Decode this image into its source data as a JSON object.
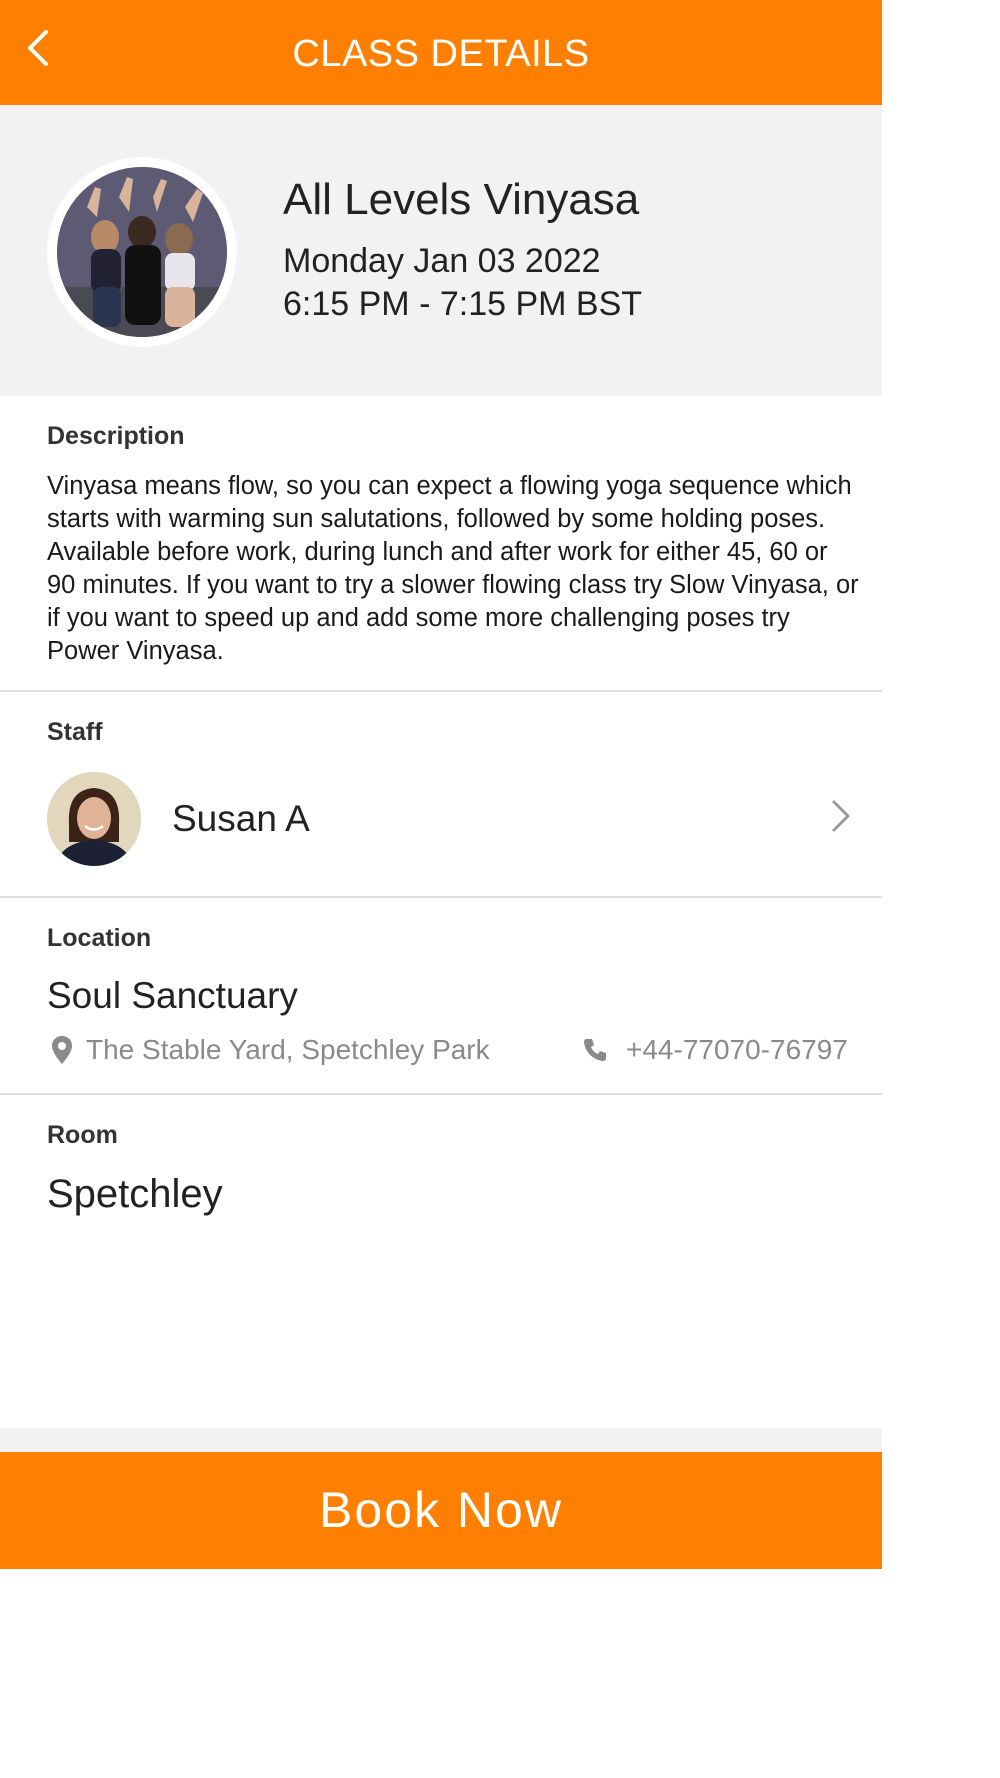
{
  "header": {
    "title": "CLASS DETAILS",
    "back_icon": "chevron-left-icon"
  },
  "class_info": {
    "title": "All Levels Vinyasa",
    "date": "Monday Jan 03 2022",
    "time": "6:15 PM - 7:15 PM BST",
    "image": "yoga-class-photo"
  },
  "description": {
    "label": "Description",
    "text": "Vinyasa means flow, so you can expect a flowing yoga sequence which starts with warming sun salutations, followed by some holding poses. Available before work, during lunch and after work for either 45, 60 or 90 minutes. If you want to try a slower flowing class try Slow Vinyasa, or if you want to speed up and add some more challenging poses try Power Vinyasa."
  },
  "staff": {
    "label": "Staff",
    "name": "Susan A",
    "avatar": "staff-photo",
    "chevron_icon": "chevron-right-icon"
  },
  "location": {
    "label": "Location",
    "name": "Soul Sanctuary",
    "address": "The Stable Yard, Spetchley Park",
    "phone": "+44-77070-76797",
    "address_icon": "map-pin-icon",
    "phone_icon": "phone-icon"
  },
  "room": {
    "label": "Room",
    "name": "Spetchley"
  },
  "book_button": {
    "label": "Book Now"
  },
  "colors": {
    "accent": "#ff7f00",
    "hero_bg": "#f2f2f2",
    "secondary_text": "#8a8a8a"
  }
}
